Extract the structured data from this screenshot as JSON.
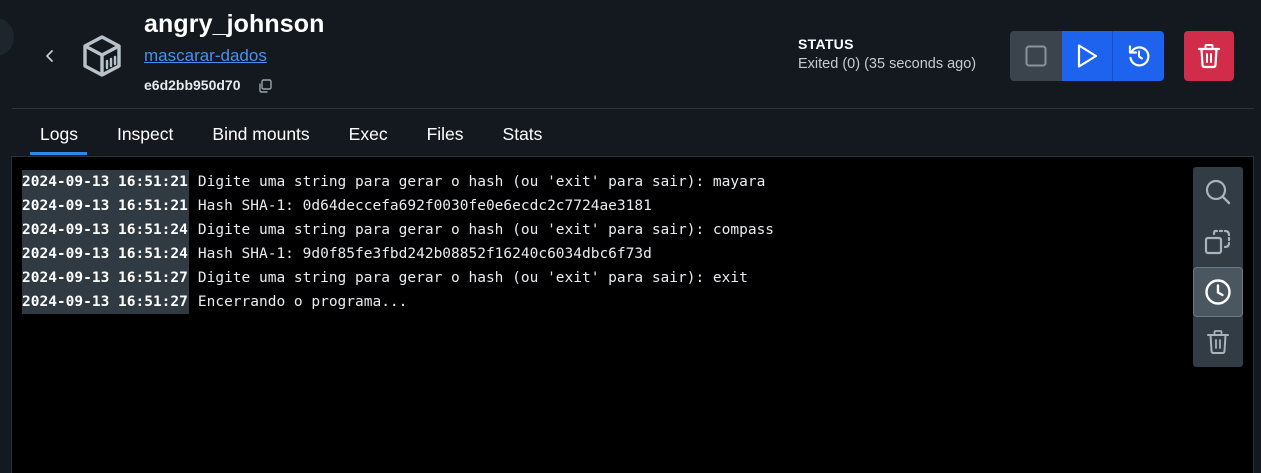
{
  "header": {
    "container_name": "angry_johnson",
    "image_name": "mascarar-dados",
    "container_id": "e6d2bb950d70",
    "status_label": "STATUS",
    "status_value": "Exited (0) (35 seconds ago)"
  },
  "tabs": [
    {
      "label": "Logs",
      "active": true
    },
    {
      "label": "Inspect",
      "active": false
    },
    {
      "label": "Bind mounts",
      "active": false
    },
    {
      "label": "Exec",
      "active": false
    },
    {
      "label": "Files",
      "active": false
    },
    {
      "label": "Stats",
      "active": false
    }
  ],
  "logs": [
    {
      "timestamp": "2024-09-13 16:51:21",
      "message": "Digite uma string para gerar o hash (ou 'exit' para sair): mayara"
    },
    {
      "timestamp": "2024-09-13 16:51:21",
      "message": "Hash SHA-1: 0d64deccefa692f0030fe0e6ecdc2c7724ae3181"
    },
    {
      "timestamp": "2024-09-13 16:51:24",
      "message": "Digite uma string para gerar o hash (ou 'exit' para sair): compass"
    },
    {
      "timestamp": "2024-09-13 16:51:24",
      "message": "Hash SHA-1: 9d0f85fe3fbd242b08852f16240c6034dbc6f73d"
    },
    {
      "timestamp": "2024-09-13 16:51:27",
      "message": "Digite uma string para gerar o hash (ou 'exit' para sair): exit"
    },
    {
      "timestamp": "2024-09-13 16:51:27",
      "message": "Encerrando o programa..."
    }
  ],
  "toolbar_icons": [
    "search-icon",
    "select-copy-icon",
    "clock-icon",
    "trash-icon"
  ],
  "header_buttons": [
    "stop-icon",
    "play-icon",
    "restart-icon",
    "trash-icon"
  ],
  "colors": {
    "accent": "#1d63ed",
    "danger": "#d12d4b",
    "link": "#4a90f0",
    "tab_indicator": "#2b89ee",
    "background": "#13191f"
  }
}
